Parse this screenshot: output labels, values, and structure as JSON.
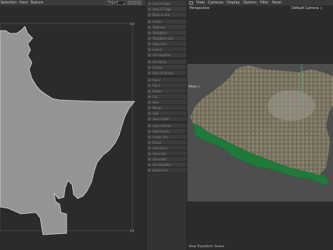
{
  "uv_editor": {
    "menu": [
      "Selection",
      "Hard",
      "Texture"
    ],
    "preset": "Project",
    "corner_labels": {
      "top_right": "1.0",
      "bottom_right": "1.0"
    }
  },
  "middle_panel": {
    "items": [
      "Cut UV Edge",
      "Sew UV Edge",
      "Move & Sew",
      "Unfold",
      "Optimize",
      "Straighten",
      "Straighten UVs",
      "Align UVs",
      "Layout",
      "UV Snapshot",
      "Normalize",
      "Unitize",
      "Map UV Border",
      "Flip U",
      "Flip V",
      "Rotate",
      "Cut",
      "Sew",
      "Merge",
      "Split",
      "Select Shell",
      "Select Border",
      "Shell Border",
      "Create UVs",
      "Planar",
      "Cylindrical",
      "Spherical",
      "Automatic",
      "UV Set Editor",
      "Delete UVs",
      "Copy UVs",
      "Paste UVs",
      "Transfer",
      "Texel Density"
    ]
  },
  "viewport": {
    "menu": [
      "View",
      "Cameras",
      "Display",
      "Options",
      "Filter",
      "Panel"
    ],
    "perspective_label": "Perspective",
    "camera_label": "Default Camera ◇",
    "mesh_label": "Mesh ◇",
    "view_transform": "View Transform: Scene"
  },
  "colors": {
    "uv_mesh": "#8f8f8f",
    "terrain_edge": "#1f7a3a",
    "background": "#2a2a2a"
  }
}
